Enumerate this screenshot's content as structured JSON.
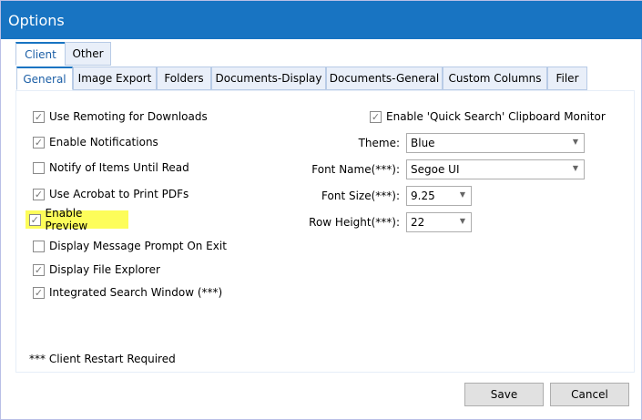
{
  "window": {
    "title": "Options"
  },
  "outer_tabs": [
    {
      "label": "Client",
      "selected": true
    },
    {
      "label": "Other",
      "selected": false
    }
  ],
  "inner_tabs": [
    {
      "label": "General",
      "selected": true
    },
    {
      "label": "Image Export"
    },
    {
      "label": "Folders"
    },
    {
      "label": "Documents-Display"
    },
    {
      "label": "Documents-General"
    },
    {
      "label": "Custom Columns"
    },
    {
      "label": "Filer"
    }
  ],
  "checkboxes": [
    {
      "label": "Use Remoting for Downloads",
      "checked": true
    },
    {
      "label": "Enable Notifications",
      "checked": true
    },
    {
      "label": "Notify of Items Until Read",
      "checked": false
    },
    {
      "label": "Use Acrobat to Print PDFs",
      "checked": true
    },
    {
      "label": "Enable Preview",
      "checked": true,
      "highlight_color": "#fdfd5a"
    },
    {
      "label": "Display Message Prompt On Exit",
      "checked": false
    },
    {
      "label": "Display File Explorer",
      "checked": true
    },
    {
      "label": "Integrated Search Window (***)",
      "checked": true
    }
  ],
  "quick_search": {
    "label": "Enable 'Quick Search' Clipboard Monitor",
    "checked": true
  },
  "fields": [
    {
      "label": "Theme:",
      "value": "Blue"
    },
    {
      "label": "Font Name(***):",
      "value": "Segoe UI"
    },
    {
      "label": "Font Size(***):",
      "value": "9.25"
    },
    {
      "label": "Row Height(***):",
      "value": "22"
    }
  ],
  "footnote": "*** Client Restart Required",
  "buttons": {
    "save": "Save",
    "cancel": "Cancel"
  },
  "colors": {
    "titlebar": "#1874c2"
  }
}
